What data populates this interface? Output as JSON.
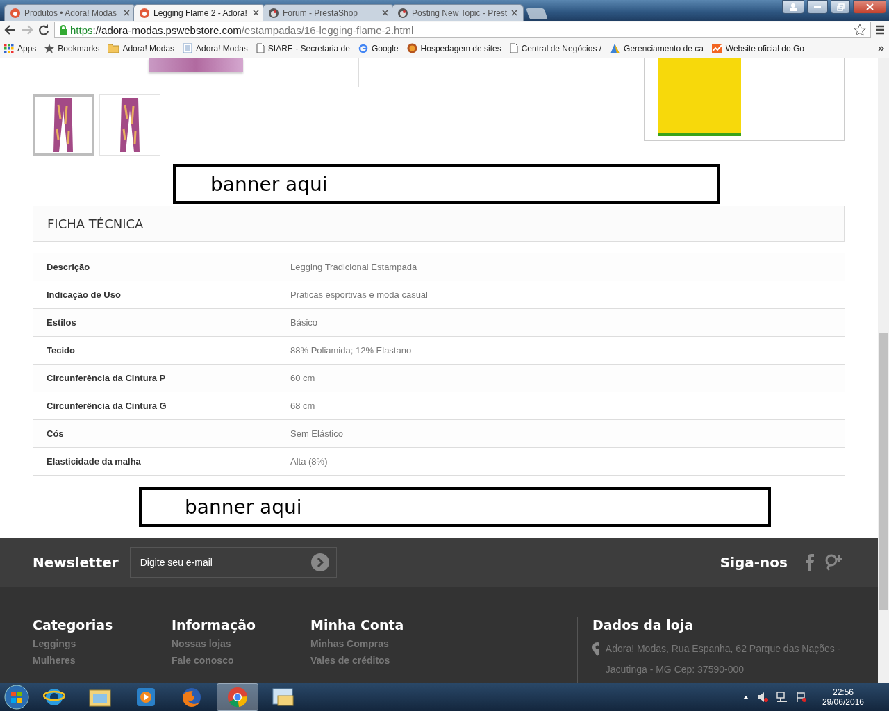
{
  "browser": {
    "tabs": [
      {
        "title": "Produtos • Adora! Modas",
        "selected": false,
        "kind": "site"
      },
      {
        "title": "Legging Flame 2 - Adora!",
        "selected": true,
        "kind": "site"
      },
      {
        "title": "Forum - PrestaShop",
        "selected": false,
        "kind": "presta"
      },
      {
        "title": "Posting New Topic - Prest",
        "selected": false,
        "kind": "presta"
      }
    ],
    "url": {
      "scheme": "https",
      "host": "://adora-modas.pswebstore.com",
      "path": "/estampadas/16-legging-flame-2.html"
    },
    "bookmarks": [
      {
        "kind": "apps",
        "label": "Apps"
      },
      {
        "kind": "star",
        "label": "Bookmarks"
      },
      {
        "kind": "folder",
        "label": "Adora! Modas"
      },
      {
        "kind": "doc",
        "label": "Adora! Modas"
      },
      {
        "kind": "page",
        "label": "SIARE - Secretaria de"
      },
      {
        "kind": "google",
        "label": "Google"
      },
      {
        "kind": "globe",
        "label": "Hospedagem de sites"
      },
      {
        "kind": "page",
        "label": "Central de Negócios /"
      },
      {
        "kind": "ads",
        "label": "Gerenciamento de ca"
      },
      {
        "kind": "chart",
        "label": "Website oficial do Go"
      }
    ]
  },
  "page": {
    "thumbnails": [
      {
        "selected": true
      },
      {
        "selected": false
      }
    ],
    "banners": [
      "banner aqui",
      "banner aqui"
    ],
    "spec": {
      "title": "FICHA TÉCNICA",
      "rows": [
        {
          "label": "Descrição",
          "value": "Legging Tradicional Estampada"
        },
        {
          "label": "Indicação de Uso",
          "value": "Praticas esportivas e moda casual"
        },
        {
          "label": "Estilos",
          "value": "Básico"
        },
        {
          "label": "Tecido",
          "value": "88% Poliamida; 12% Elastano"
        },
        {
          "label": "Circunferência da Cintura P",
          "value": "60 cm"
        },
        {
          "label": "Circunferência da Cintura G",
          "value": "68 cm"
        },
        {
          "label": "Cós",
          "value": "Sem Elástico"
        },
        {
          "label": "Elasticidade da malha",
          "value": "Alta (8%)"
        }
      ]
    },
    "newsletter": {
      "title": "Newsletter",
      "placeholder": "Digite seu e-mail"
    },
    "social": {
      "title": "Siga-nos"
    },
    "footer_columns": [
      {
        "title": "Categorias",
        "links": [
          "Leggings",
          "Mulheres"
        ]
      },
      {
        "title": "Informação",
        "links": [
          "Nossas lojas",
          "Fale conosco"
        ]
      },
      {
        "title": "Minha Conta",
        "links": [
          "Minhas Compras",
          "Vales de créditos"
        ]
      }
    ],
    "store": {
      "title": "Dados da loja",
      "address": "Adora! Modas, Rua Espanha, 62 Parque das Nações - Jacutinga - MG Cep: 37590-000"
    }
  },
  "taskbar": {
    "apps": [
      {
        "kind": "ie",
        "selected": false
      },
      {
        "kind": "explorer",
        "selected": false
      },
      {
        "kind": "media",
        "selected": false
      },
      {
        "kind": "firefox",
        "selected": false
      },
      {
        "kind": "chrome",
        "selected": true
      },
      {
        "kind": "mail",
        "selected": false
      }
    ],
    "time": "22:56",
    "date": "29/06/2016"
  }
}
